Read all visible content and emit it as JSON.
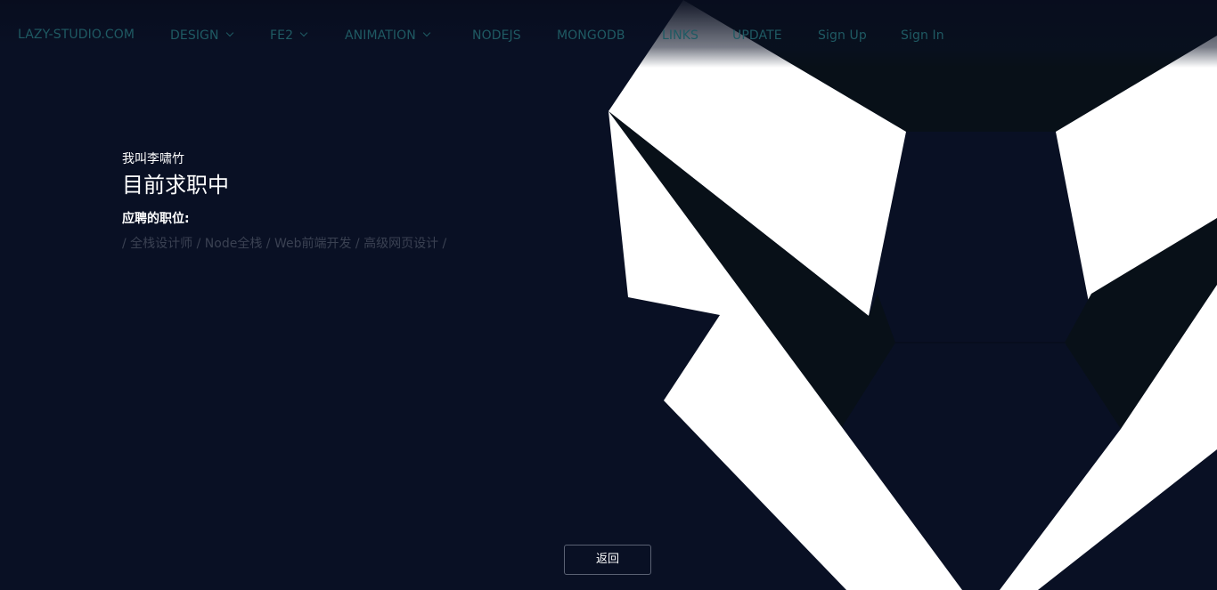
{
  "nav": {
    "brand": "LAZY-STUDIO.COM",
    "items": [
      {
        "label": "DESIGN"
      },
      {
        "label": "FE2"
      },
      {
        "label": "ANIMATION"
      },
      {
        "label": "NODEJS"
      },
      {
        "label": "MONGODB"
      },
      {
        "label": "LINKS"
      },
      {
        "label": "UPDATE"
      },
      {
        "label": "Sign Up"
      },
      {
        "label": "Sign In"
      }
    ]
  },
  "intro": {
    "name": "我叫李啸竹",
    "headline": "目前求职中",
    "positions_label": "应聘的职位:",
    "positions_text": "/ 全栈设计师 / Node全栈 / Web前端开发 / 高级网页设计 /"
  },
  "back_button": {
    "label": "返回"
  },
  "colors": {
    "background": "#091024",
    "nav_text": "#1f5a63",
    "logo_white": "#ffffff",
    "logo_dark": "#081018"
  }
}
